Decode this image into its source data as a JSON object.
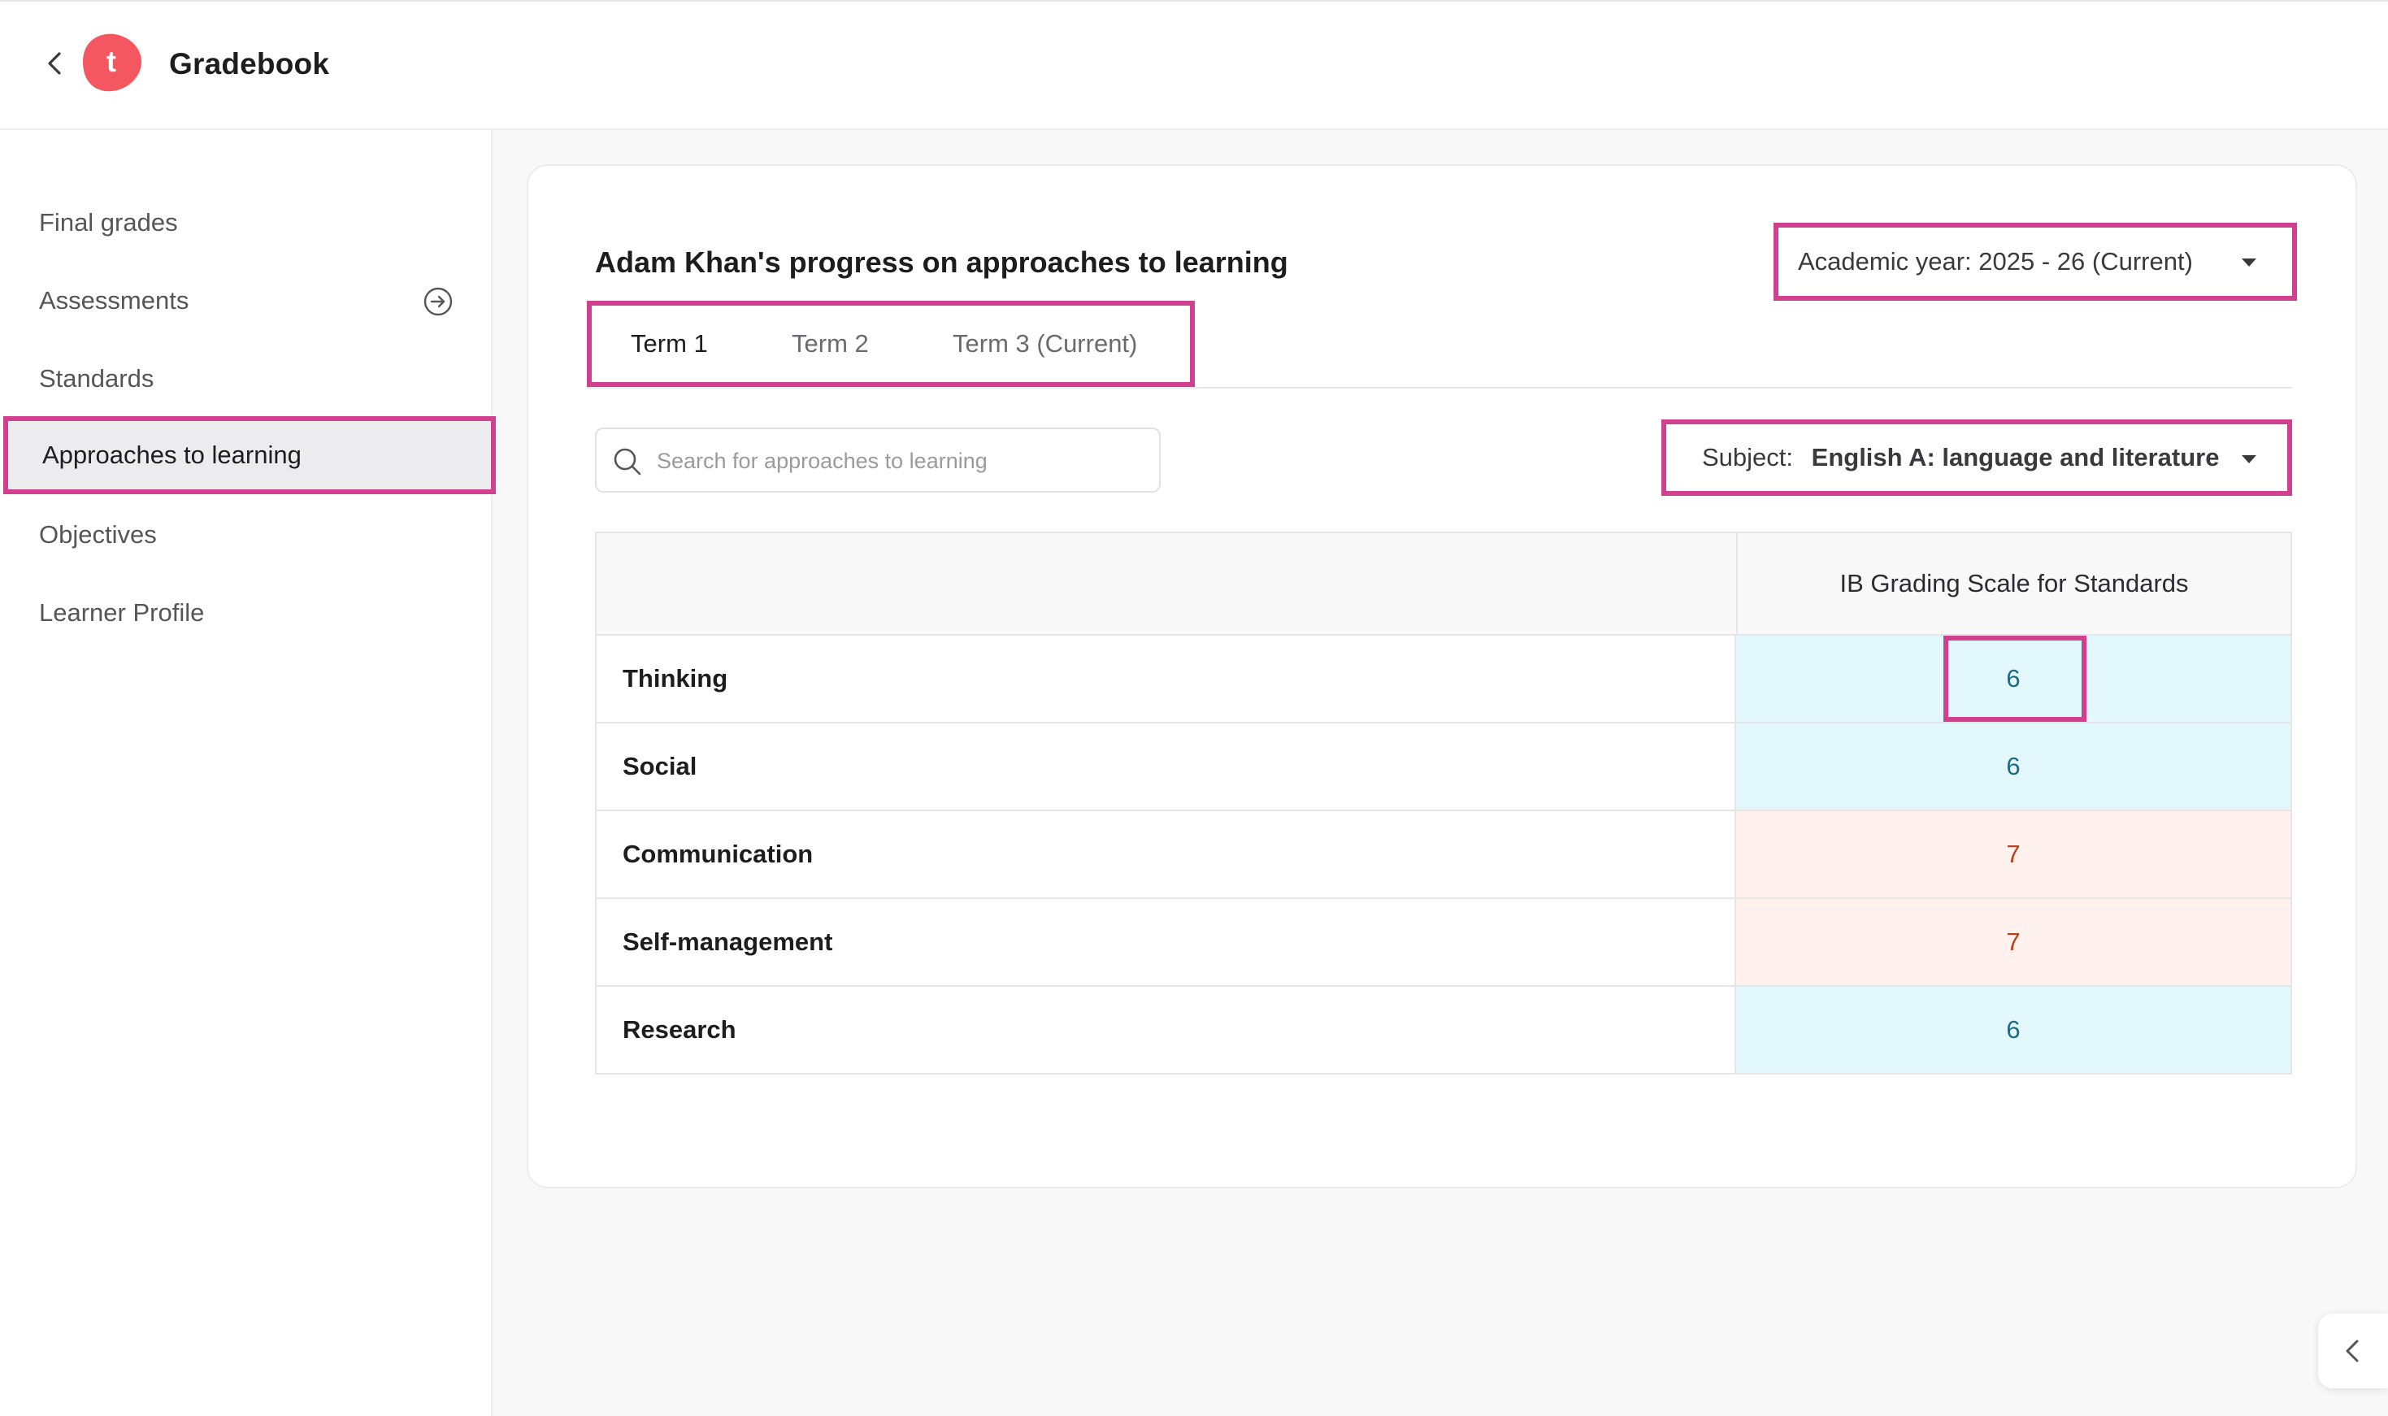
{
  "app": {
    "title": "Gradebook",
    "logo_letter": "t",
    "brand_color": "#f4575f",
    "highlight_color": "#d0408f"
  },
  "sidebar": {
    "items": [
      {
        "label": "Final grades"
      },
      {
        "label": "Assessments",
        "icon": "circle-arrow-right-icon"
      },
      {
        "label": "Standards"
      },
      {
        "label": "Approaches to learning",
        "active": true
      },
      {
        "label": "Objectives"
      },
      {
        "label": "Learner Profile"
      }
    ]
  },
  "main": {
    "title": "Adam Khan's progress on approaches to learning",
    "academic_year": {
      "label": "Academic year:",
      "value": "2025 - 26 (Current)"
    },
    "tabs": [
      {
        "label": "Term 1",
        "active": true
      },
      {
        "label": "Term 2"
      },
      {
        "label": "Term 3 (Current)"
      }
    ],
    "search": {
      "placeholder": "Search for approaches to learning",
      "value": ""
    },
    "subject": {
      "label": "Subject:",
      "value": "English A: language and literature"
    },
    "table": {
      "column_header": "IB Grading Scale for Standards",
      "rows": [
        {
          "name": "Thinking",
          "grade": "6",
          "tone": "blue"
        },
        {
          "name": "Social",
          "grade": "6",
          "tone": "blue"
        },
        {
          "name": "Communication",
          "grade": "7",
          "tone": "pink"
        },
        {
          "name": "Self-management",
          "grade": "7",
          "tone": "pink"
        },
        {
          "name": "Research",
          "grade": "6",
          "tone": "blue"
        }
      ]
    }
  }
}
